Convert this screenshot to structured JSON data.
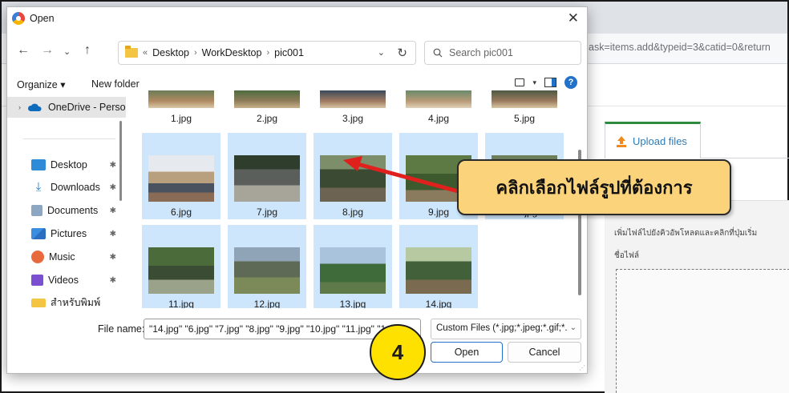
{
  "background": {
    "url_text": "ask=items.add&typeid=3&catid=0&return",
    "upload_tab_label": "Upload files",
    "panel_title": "",
    "panel_hint": "เพิ่มไฟล์ไปยังคิวอัพโหลดและคลิกที่ปุ่มเริ่ม",
    "filename_label": "ชื่อไฟล์"
  },
  "dialog": {
    "title": "Open",
    "address": {
      "overflow": "«",
      "crumbs": [
        "Desktop",
        "WorkDesktop",
        "pic001"
      ]
    },
    "search_placeholder": "Search pic001",
    "toolbar": {
      "organize": "Organize ▾",
      "new_folder": "New folder"
    },
    "nav_items": [
      {
        "label": "OneDrive - Perso",
        "pinned": false
      },
      {
        "label": "Desktop",
        "pinned": true
      },
      {
        "label": "Downloads",
        "pinned": true
      },
      {
        "label": "Documents",
        "pinned": true
      },
      {
        "label": "Pictures",
        "pinned": true
      },
      {
        "label": "Music",
        "pinned": true
      },
      {
        "label": "Videos",
        "pinned": true
      },
      {
        "label": "สำหรับพิมพ์",
        "pinned": false
      }
    ],
    "files": [
      {
        "name": "1.jpg",
        "selected": false
      },
      {
        "name": "2.jpg",
        "selected": false
      },
      {
        "name": "3.jpg",
        "selected": false
      },
      {
        "name": "4.jpg",
        "selected": false
      },
      {
        "name": "5.jpg",
        "selected": false
      },
      {
        "name": "6.jpg",
        "selected": true
      },
      {
        "name": "7.jpg",
        "selected": true
      },
      {
        "name": "8.jpg",
        "selected": true
      },
      {
        "name": "9.jpg",
        "selected": true
      },
      {
        "name": "10.jpg",
        "selected": true
      },
      {
        "name": "11.jpg",
        "selected": true
      },
      {
        "name": "12.jpg",
        "selected": true
      },
      {
        "name": "13.jpg",
        "selected": true
      },
      {
        "name": "14.jpg",
        "selected": true
      }
    ],
    "file_name_label": "File name:",
    "file_name_value": "\"14.jpg\" \"6.jpg\" \"7.jpg\" \"8.jpg\" \"9.jpg\" \"10.jpg\" \"11.jpg\" \"1",
    "file_type": "Custom Files (*.jpg;*.jpeg;*.gif;*.",
    "open_label": "Open",
    "cancel_label": "Cancel"
  },
  "annotation": {
    "callout_text": "คลิกเลือกไฟล์รูปที่ต้องการ",
    "step_number": "4"
  },
  "colors": {
    "selection": "#cde6fb",
    "accent": "#2372c9",
    "callout": "#fbd37a",
    "step": "#ffe100",
    "arrow": "#e0201c"
  }
}
